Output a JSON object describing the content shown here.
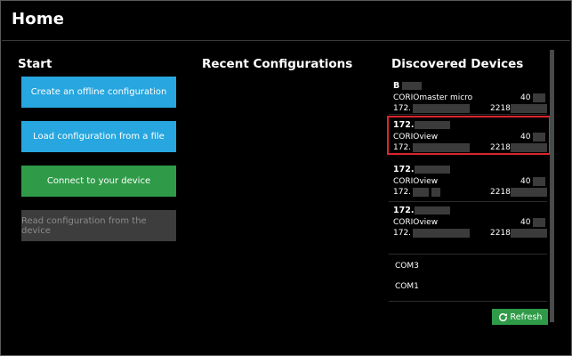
{
  "page": {
    "title": "Home"
  },
  "start": {
    "title": "Start",
    "buttons": [
      {
        "label": "Create an offline configuration",
        "state": "enabled",
        "color": "#27a6df"
      },
      {
        "label": "Load configuration from a file",
        "state": "enabled",
        "color": "#27a6df"
      },
      {
        "label": "Connect to your device",
        "state": "enabled",
        "color": "#2f9b48"
      },
      {
        "label": "Read configuration from the device",
        "state": "disabled",
        "color": "#3d3d3d"
      }
    ]
  },
  "recent": {
    "title": "Recent Configurations"
  },
  "devices": {
    "title": "Discovered Devices",
    "items": [
      {
        "name": "B",
        "model": "CORIOmaster micro",
        "ip": "172.",
        "right_top": "40",
        "right_bottom": "2218",
        "selected": false
      },
      {
        "name": "172.",
        "model": "CORIOview",
        "ip": "172.",
        "right_top": "40",
        "right_bottom": "2218",
        "selected": true
      },
      {
        "name": "172.",
        "model": "CORIOview",
        "ip": "172.",
        "right_top": "40",
        "right_bottom": "2218",
        "selected": false
      },
      {
        "name": "172.",
        "model": "CORIOview",
        "ip": "172.",
        "right_top": "40",
        "right_bottom": "2218",
        "selected": false
      }
    ],
    "ports": [
      "COM3",
      "COM1"
    ],
    "refresh_label": "Refresh",
    "selection_color": "#d9262e"
  }
}
